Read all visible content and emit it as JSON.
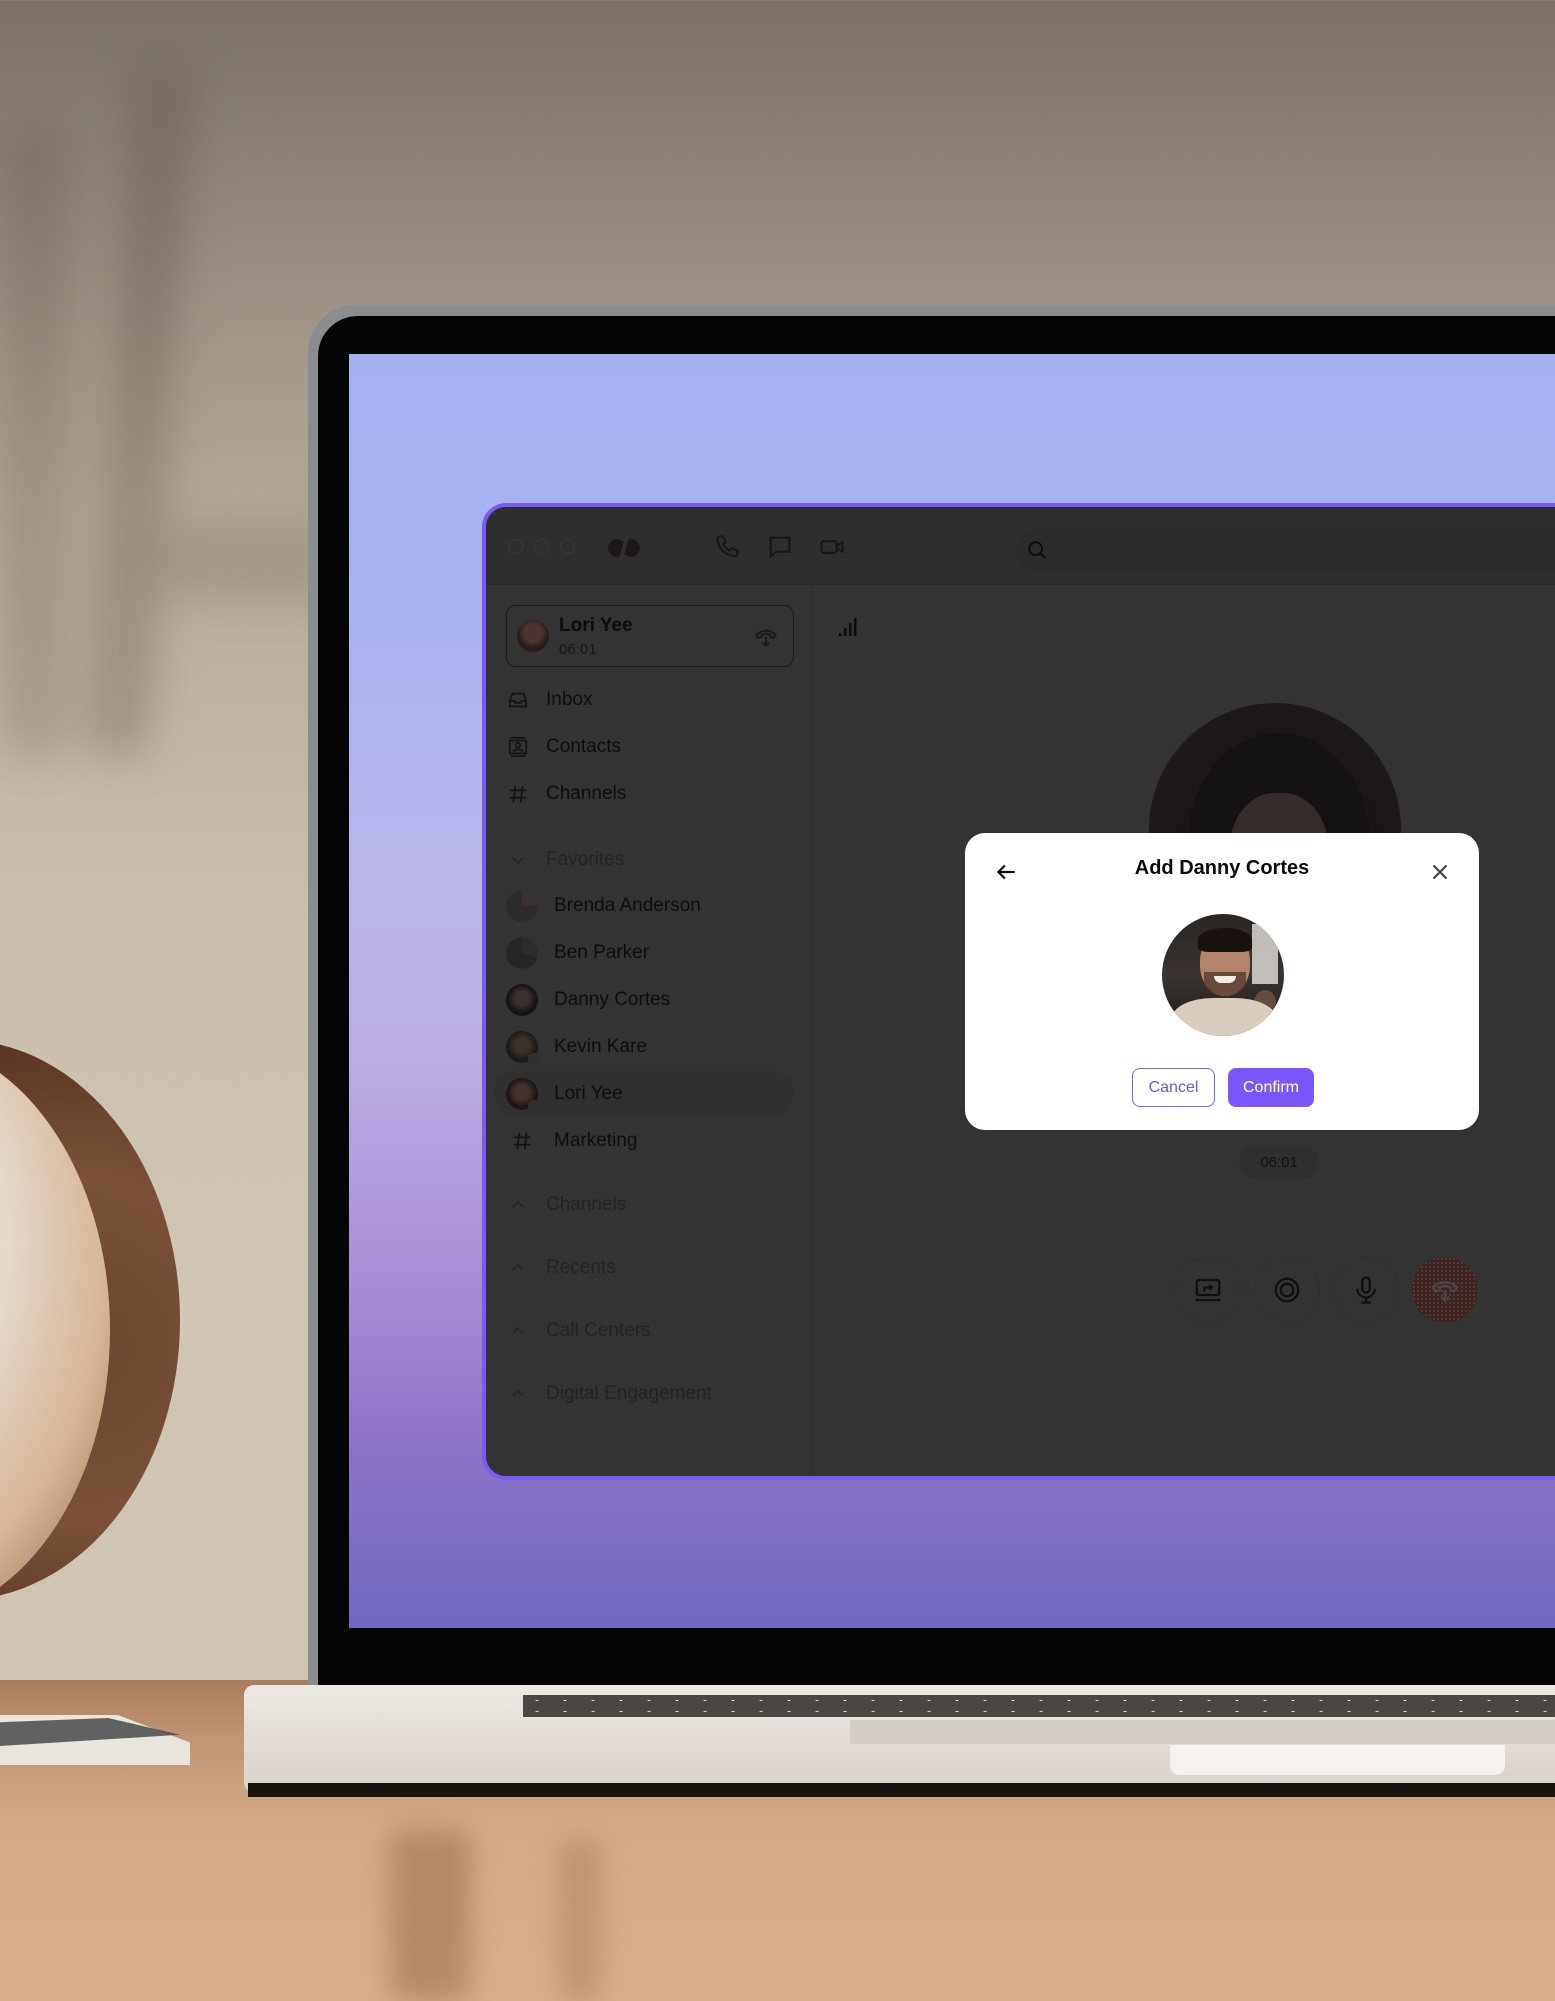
{
  "scene": {
    "description": "Laptop on wooden desk showing a calling app with a modal dialog",
    "accent_color": "#7b57fb",
    "window_border_color": "#7b59f3"
  },
  "titlebar": {
    "icons": [
      "window-close-dot",
      "window-minimize-dot",
      "window-maximize-dot",
      "app-logo",
      "phone-icon",
      "chat-icon",
      "video-icon"
    ],
    "search_placeholder": ""
  },
  "active_call": {
    "name": "Lori Yee",
    "duration": "06:01",
    "hangup_icon": "phone-hangup-icon"
  },
  "sidebar": {
    "nav": [
      {
        "label": "Inbox",
        "icon": "inbox-icon"
      },
      {
        "label": "Contacts",
        "icon": "contacts-icon"
      },
      {
        "label": "Channels",
        "icon": "hash-icon"
      }
    ],
    "favorites": {
      "label": "Favorites",
      "expanded": true,
      "items": [
        {
          "label": "Brenda Anderson",
          "type": "contact"
        },
        {
          "label": "Ben Parker",
          "type": "contact"
        },
        {
          "label": "Danny Cortes",
          "type": "contact"
        },
        {
          "label": "Kevin Kare",
          "type": "contact",
          "status": true
        },
        {
          "label": "Lori Yee",
          "type": "contact",
          "status": true,
          "active": true
        },
        {
          "label": "Marketing",
          "type": "channel"
        }
      ]
    },
    "sections": [
      {
        "label": "Channels"
      },
      {
        "label": "Recents"
      },
      {
        "label": "Call Centers"
      },
      {
        "label": "Digital Engagement"
      }
    ]
  },
  "call_view": {
    "signal_icon": "signal-bars-icon",
    "timer": "06:01",
    "controls": [
      {
        "name": "share-screen-button",
        "icon": "share-screen-icon"
      },
      {
        "name": "record-button",
        "icon": "record-icon"
      },
      {
        "name": "mute-button",
        "icon": "microphone-icon"
      },
      {
        "name": "end-call-button",
        "icon": "phone-hangup-icon"
      }
    ]
  },
  "modal": {
    "title": "Add Danny Cortes",
    "cancel_label": "Cancel",
    "confirm_label": "Confirm"
  }
}
